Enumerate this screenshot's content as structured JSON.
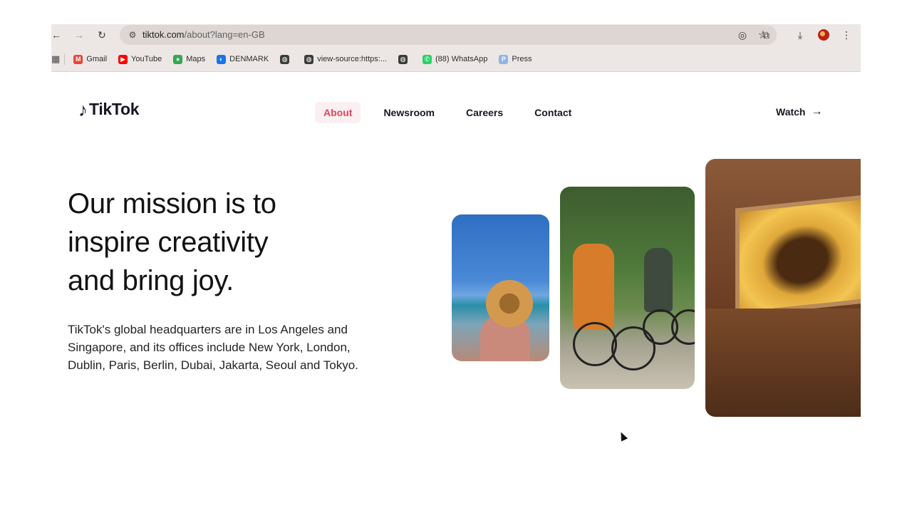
{
  "browser": {
    "url_host": "tiktok.com",
    "url_path": "/about?lang=en-GB",
    "bookmarks": [
      {
        "label": "Gmail",
        "icon": "gmail-icon",
        "color": "#ea4335",
        "glyph": "M"
      },
      {
        "label": "YouTube",
        "icon": "youtube-icon",
        "color": "#ff0000",
        "glyph": "▶"
      },
      {
        "label": "Maps",
        "icon": "maps-icon",
        "color": "#34a853",
        "glyph": "●"
      },
      {
        "label": "DENMARK",
        "icon": "globe-blue-icon",
        "color": "#1a73e8",
        "glyph": "◐"
      },
      {
        "label": "",
        "icon": "globe-icon",
        "color": "#3c3c3c",
        "glyph": "◍"
      },
      {
        "label": "view-source:https:...",
        "icon": "globe-icon",
        "color": "#3c3c3c",
        "glyph": "◍"
      },
      {
        "label": "",
        "icon": "globe-icon",
        "color": "#3c3c3c",
        "glyph": "◍"
      },
      {
        "label": "(88) WhatsApp",
        "icon": "whatsapp-icon",
        "color": "#25d366",
        "glyph": "✆"
      },
      {
        "label": "Press",
        "icon": "press-icon",
        "color": "#8fb4e6",
        "glyph": "P"
      }
    ]
  },
  "header": {
    "logo_text": "TikTok",
    "nav": [
      {
        "label": "About",
        "active": true
      },
      {
        "label": "Newsroom",
        "active": false
      },
      {
        "label": "Careers",
        "active": false
      },
      {
        "label": "Contact",
        "active": false
      }
    ],
    "watch_label": "Watch"
  },
  "hero": {
    "headline_lines": [
      "Our mission is to",
      "inspire creativity",
      "and bring joy."
    ],
    "body": "TikTok's global headquarters are in Los Angeles and Singapore, and its offices include New York, London, Dublin, Paris, Berlin, Dubai, Jakarta, Seoul and Tokyo."
  },
  "colors": {
    "accent": "#e9445a",
    "text": "#161823"
  }
}
